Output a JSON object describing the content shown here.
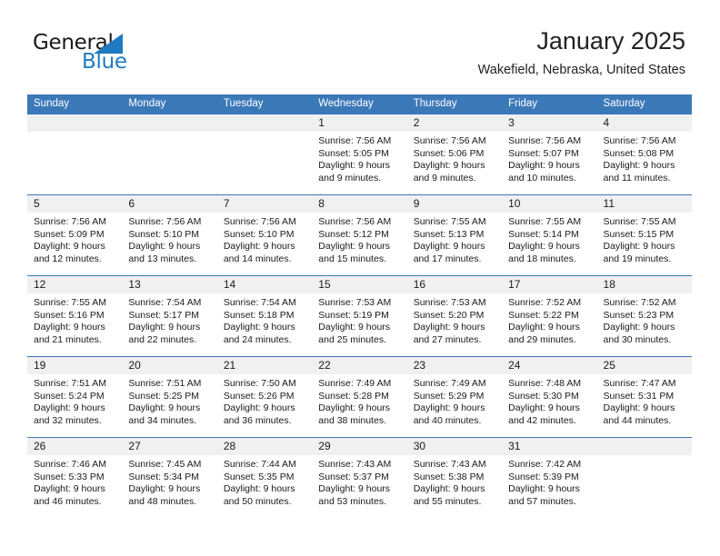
{
  "brand": {
    "name_part1": "General",
    "name_part2": "Blue",
    "logo_icon": "triangle-flag-icon",
    "accent_color": "#1f7bc1"
  },
  "header": {
    "month_title": "January 2025",
    "location": "Wakefield, Nebraska, United States"
  },
  "theme": {
    "header_blue": "#3b78b8",
    "day_band_gray": "#f0f0f0",
    "text_black": "#1a1a1a"
  },
  "calendar": {
    "weekday_headers": [
      "Sunday",
      "Monday",
      "Tuesday",
      "Wednesday",
      "Thursday",
      "Friday",
      "Saturday"
    ],
    "weeks": [
      [
        {
          "day": "",
          "empty": true
        },
        {
          "day": "",
          "empty": true
        },
        {
          "day": "",
          "empty": true
        },
        {
          "day": "1",
          "sunrise": "Sunrise: 7:56 AM",
          "sunset": "Sunset: 5:05 PM",
          "daylight1": "Daylight: 9 hours",
          "daylight2": "and 9 minutes."
        },
        {
          "day": "2",
          "sunrise": "Sunrise: 7:56 AM",
          "sunset": "Sunset: 5:06 PM",
          "daylight1": "Daylight: 9 hours",
          "daylight2": "and 9 minutes."
        },
        {
          "day": "3",
          "sunrise": "Sunrise: 7:56 AM",
          "sunset": "Sunset: 5:07 PM",
          "daylight1": "Daylight: 9 hours",
          "daylight2": "and 10 minutes."
        },
        {
          "day": "4",
          "sunrise": "Sunrise: 7:56 AM",
          "sunset": "Sunset: 5:08 PM",
          "daylight1": "Daylight: 9 hours",
          "daylight2": "and 11 minutes."
        }
      ],
      [
        {
          "day": "5",
          "sunrise": "Sunrise: 7:56 AM",
          "sunset": "Sunset: 5:09 PM",
          "daylight1": "Daylight: 9 hours",
          "daylight2": "and 12 minutes."
        },
        {
          "day": "6",
          "sunrise": "Sunrise: 7:56 AM",
          "sunset": "Sunset: 5:10 PM",
          "daylight1": "Daylight: 9 hours",
          "daylight2": "and 13 minutes."
        },
        {
          "day": "7",
          "sunrise": "Sunrise: 7:56 AM",
          "sunset": "Sunset: 5:10 PM",
          "daylight1": "Daylight: 9 hours",
          "daylight2": "and 14 minutes."
        },
        {
          "day": "8",
          "sunrise": "Sunrise: 7:56 AM",
          "sunset": "Sunset: 5:12 PM",
          "daylight1": "Daylight: 9 hours",
          "daylight2": "and 15 minutes."
        },
        {
          "day": "9",
          "sunrise": "Sunrise: 7:55 AM",
          "sunset": "Sunset: 5:13 PM",
          "daylight1": "Daylight: 9 hours",
          "daylight2": "and 17 minutes."
        },
        {
          "day": "10",
          "sunrise": "Sunrise: 7:55 AM",
          "sunset": "Sunset: 5:14 PM",
          "daylight1": "Daylight: 9 hours",
          "daylight2": "and 18 minutes."
        },
        {
          "day": "11",
          "sunrise": "Sunrise: 7:55 AM",
          "sunset": "Sunset: 5:15 PM",
          "daylight1": "Daylight: 9 hours",
          "daylight2": "and 19 minutes."
        }
      ],
      [
        {
          "day": "12",
          "sunrise": "Sunrise: 7:55 AM",
          "sunset": "Sunset: 5:16 PM",
          "daylight1": "Daylight: 9 hours",
          "daylight2": "and 21 minutes."
        },
        {
          "day": "13",
          "sunrise": "Sunrise: 7:54 AM",
          "sunset": "Sunset: 5:17 PM",
          "daylight1": "Daylight: 9 hours",
          "daylight2": "and 22 minutes."
        },
        {
          "day": "14",
          "sunrise": "Sunrise: 7:54 AM",
          "sunset": "Sunset: 5:18 PM",
          "daylight1": "Daylight: 9 hours",
          "daylight2": "and 24 minutes."
        },
        {
          "day": "15",
          "sunrise": "Sunrise: 7:53 AM",
          "sunset": "Sunset: 5:19 PM",
          "daylight1": "Daylight: 9 hours",
          "daylight2": "and 25 minutes."
        },
        {
          "day": "16",
          "sunrise": "Sunrise: 7:53 AM",
          "sunset": "Sunset: 5:20 PM",
          "daylight1": "Daylight: 9 hours",
          "daylight2": "and 27 minutes."
        },
        {
          "day": "17",
          "sunrise": "Sunrise: 7:52 AM",
          "sunset": "Sunset: 5:22 PM",
          "daylight1": "Daylight: 9 hours",
          "daylight2": "and 29 minutes."
        },
        {
          "day": "18",
          "sunrise": "Sunrise: 7:52 AM",
          "sunset": "Sunset: 5:23 PM",
          "daylight1": "Daylight: 9 hours",
          "daylight2": "and 30 minutes."
        }
      ],
      [
        {
          "day": "19",
          "sunrise": "Sunrise: 7:51 AM",
          "sunset": "Sunset: 5:24 PM",
          "daylight1": "Daylight: 9 hours",
          "daylight2": "and 32 minutes."
        },
        {
          "day": "20",
          "sunrise": "Sunrise: 7:51 AM",
          "sunset": "Sunset: 5:25 PM",
          "daylight1": "Daylight: 9 hours",
          "daylight2": "and 34 minutes."
        },
        {
          "day": "21",
          "sunrise": "Sunrise: 7:50 AM",
          "sunset": "Sunset: 5:26 PM",
          "daylight1": "Daylight: 9 hours",
          "daylight2": "and 36 minutes."
        },
        {
          "day": "22",
          "sunrise": "Sunrise: 7:49 AM",
          "sunset": "Sunset: 5:28 PM",
          "daylight1": "Daylight: 9 hours",
          "daylight2": "and 38 minutes."
        },
        {
          "day": "23",
          "sunrise": "Sunrise: 7:49 AM",
          "sunset": "Sunset: 5:29 PM",
          "daylight1": "Daylight: 9 hours",
          "daylight2": "and 40 minutes."
        },
        {
          "day": "24",
          "sunrise": "Sunrise: 7:48 AM",
          "sunset": "Sunset: 5:30 PM",
          "daylight1": "Daylight: 9 hours",
          "daylight2": "and 42 minutes."
        },
        {
          "day": "25",
          "sunrise": "Sunrise: 7:47 AM",
          "sunset": "Sunset: 5:31 PM",
          "daylight1": "Daylight: 9 hours",
          "daylight2": "and 44 minutes."
        }
      ],
      [
        {
          "day": "26",
          "sunrise": "Sunrise: 7:46 AM",
          "sunset": "Sunset: 5:33 PM",
          "daylight1": "Daylight: 9 hours",
          "daylight2": "and 46 minutes."
        },
        {
          "day": "27",
          "sunrise": "Sunrise: 7:45 AM",
          "sunset": "Sunset: 5:34 PM",
          "daylight1": "Daylight: 9 hours",
          "daylight2": "and 48 minutes."
        },
        {
          "day": "28",
          "sunrise": "Sunrise: 7:44 AM",
          "sunset": "Sunset: 5:35 PM",
          "daylight1": "Daylight: 9 hours",
          "daylight2": "and 50 minutes."
        },
        {
          "day": "29",
          "sunrise": "Sunrise: 7:43 AM",
          "sunset": "Sunset: 5:37 PM",
          "daylight1": "Daylight: 9 hours",
          "daylight2": "and 53 minutes."
        },
        {
          "day": "30",
          "sunrise": "Sunrise: 7:43 AM",
          "sunset": "Sunset: 5:38 PM",
          "daylight1": "Daylight: 9 hours",
          "daylight2": "and 55 minutes."
        },
        {
          "day": "31",
          "sunrise": "Sunrise: 7:42 AM",
          "sunset": "Sunset: 5:39 PM",
          "daylight1": "Daylight: 9 hours",
          "daylight2": "and 57 minutes."
        },
        {
          "day": "",
          "empty": true
        }
      ]
    ]
  }
}
